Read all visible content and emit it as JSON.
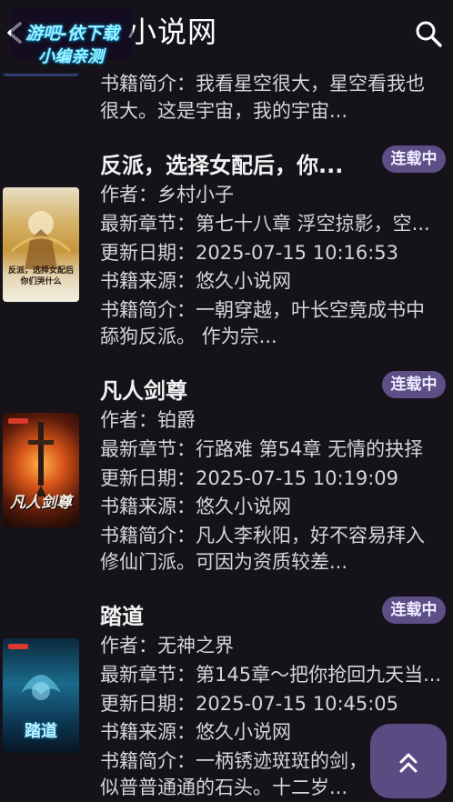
{
  "header": {
    "title": "小说网",
    "watermark_line1": "游吧-依下载",
    "watermark_line2": "小编亲测"
  },
  "books": [
    {
      "name": "",
      "status": "",
      "intro_line1": "书籍简介：我看星空很大，星空看我也",
      "intro_line2": "很大。这是宇宙，我的宇宙..."
    },
    {
      "name": "反派，选择女配后，你...",
      "status": "连载中",
      "author": "作者：乡村小子",
      "latest": "最新章节：第七十八章 浮空掠影，空...",
      "updated": "更新日期：2025-07-15 10:16:53",
      "source": "书籍来源：悠久小说网",
      "intro_line1": "书籍简介：一朝穿越，叶长空竟成书中",
      "intro_line2": "舔狗反派。 作为宗...",
      "cover_text": "反派，选择女配后你们哭什么"
    },
    {
      "name": "凡人剑尊",
      "status": "连载中",
      "author": "作者：铂爵",
      "latest": "最新章节：行路难 第54章 无情的抉择",
      "updated": "更新日期：2025-07-15 10:19:09",
      "source": "书籍来源：悠久小说网",
      "intro_line1": "书籍简介：凡人李秋阳，好不容易拜入",
      "intro_line2": "修仙门派。可因为资质较差...",
      "cover_text": "凡人剑尊"
    },
    {
      "name": "踏道",
      "status": "连载中",
      "author": "作者：无神之界",
      "latest": "最新章节：第145章～把你抢回九天当...",
      "updated": "更新日期：2025-07-15 10:45:05",
      "source": "书籍来源：悠久小说网",
      "intro_line1": "书籍简介：一柄锈迹斑斑的剑，",
      "intro_line2": "似普普通通的石头。十二岁...",
      "cover_text": "踏道"
    }
  ],
  "icons": {
    "back": "arrow-left-icon",
    "search": "search-icon",
    "scroll_top": "double-chevron-up-icon"
  },
  "colors": {
    "background": "#151219",
    "badge": "#5c4f86",
    "fab": "#5a4b82"
  }
}
